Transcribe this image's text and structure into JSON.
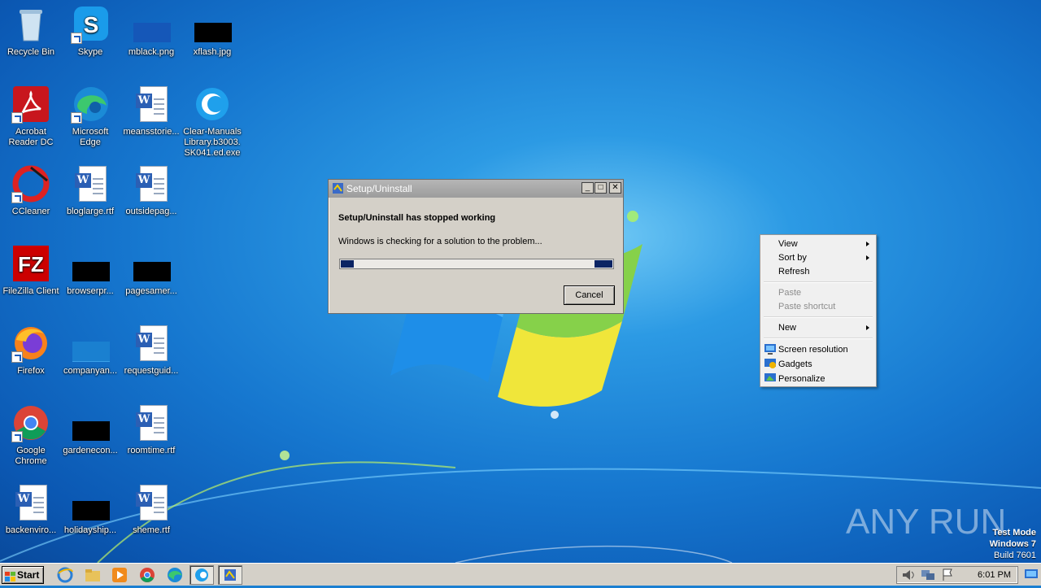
{
  "desktop_icons": [
    {
      "label": "Recycle Bin",
      "icon": "recycle-bin-icon"
    },
    {
      "label": "Skype",
      "icon": "skype-icon"
    },
    {
      "label": "mblack.png",
      "icon": "image-file-icon"
    },
    {
      "label": "xflash.jpg",
      "icon": "image-file-icon"
    },
    {
      "label": "Acrobat Reader DC",
      "icon": "acrobat-icon"
    },
    {
      "label": "Microsoft Edge",
      "icon": "edge-icon"
    },
    {
      "label": "meansstorie...",
      "icon": "word-document-icon"
    },
    {
      "label": "Clear-Manuals Library.b3003. SK041.ed.exe",
      "icon": "clear-app-icon"
    },
    {
      "label": "CCleaner",
      "icon": "ccleaner-icon"
    },
    {
      "label": "bloglarge.rtf",
      "icon": "word-document-icon"
    },
    {
      "label": "outsidepag...",
      "icon": "word-document-icon"
    },
    {
      "label": "FileZilla Client",
      "icon": "filezilla-icon"
    },
    {
      "label": "browserpr...",
      "icon": "image-file-icon"
    },
    {
      "label": "pagesamer...",
      "icon": "image-file-icon"
    },
    {
      "label": "Firefox",
      "icon": "firefox-icon"
    },
    {
      "label": "companyan...",
      "icon": "image-file-icon"
    },
    {
      "label": "requestguid...",
      "icon": "word-document-icon"
    },
    {
      "label": "Google Chrome",
      "icon": "chrome-icon"
    },
    {
      "label": "gardenecon...",
      "icon": "image-file-icon"
    },
    {
      "label": "roomtime.rtf",
      "icon": "word-document-icon"
    },
    {
      "label": "backenviro...",
      "icon": "word-document-icon"
    },
    {
      "label": "holidayship...",
      "icon": "image-file-icon"
    },
    {
      "label": "sheme.rtf",
      "icon": "word-document-icon"
    }
  ],
  "dialog": {
    "title": "Setup/Uninstall",
    "heading": "Setup/Uninstall has stopped working",
    "message": "Windows is checking for a solution to the problem...",
    "cancel_label": "Cancel",
    "minimize_glyph": "_",
    "maximize_glyph": "□",
    "close_glyph": "✕"
  },
  "context_menu": {
    "view": "View",
    "sort_by": "Sort by",
    "refresh": "Refresh",
    "paste": "Paste",
    "paste_shortcut": "Paste shortcut",
    "new": "New",
    "screen_resolution": "Screen resolution",
    "gadgets": "Gadgets",
    "personalize": "Personalize"
  },
  "taskbar": {
    "start_label": "Start",
    "clock": "6:01 PM"
  },
  "watermark": {
    "line1": "Test Mode",
    "line2": "Windows 7",
    "line3": "Build 7601",
    "brand": "ANY RUN"
  },
  "colors": {
    "desktop_blue": "#1677cf",
    "dialog_face": "#d4d0c8",
    "progress_fill": "#0b2463"
  }
}
